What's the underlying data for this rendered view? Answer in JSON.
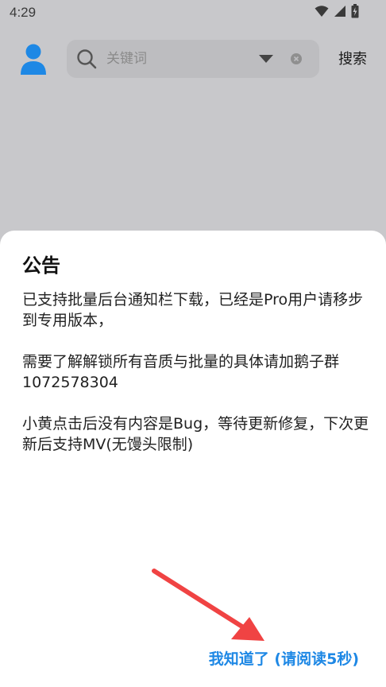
{
  "status_bar": {
    "time": "4:29",
    "icons": [
      "wifi-icon",
      "signal-icon",
      "battery-icon"
    ]
  },
  "header": {
    "search": {
      "placeholder": "关键词",
      "value": ""
    },
    "search_button_label": "搜索"
  },
  "dialog": {
    "title": "公告",
    "paragraphs": [
      "已支持批量后台通知栏下载，已经是Pro用户请移步到专用版本，",
      "需要了解解锁所有音质与批量的具体请加鹅子群 1072578304",
      "小黄点击后没有内容是Bug，等待更新修复，下次更新后支持MV(无馒头限制)"
    ],
    "confirm_label": "我知道了 (请阅读5秒)"
  },
  "colors": {
    "accent": "#1e88e5",
    "overlay": "#c8c8cb",
    "arrow": "#f04343"
  }
}
